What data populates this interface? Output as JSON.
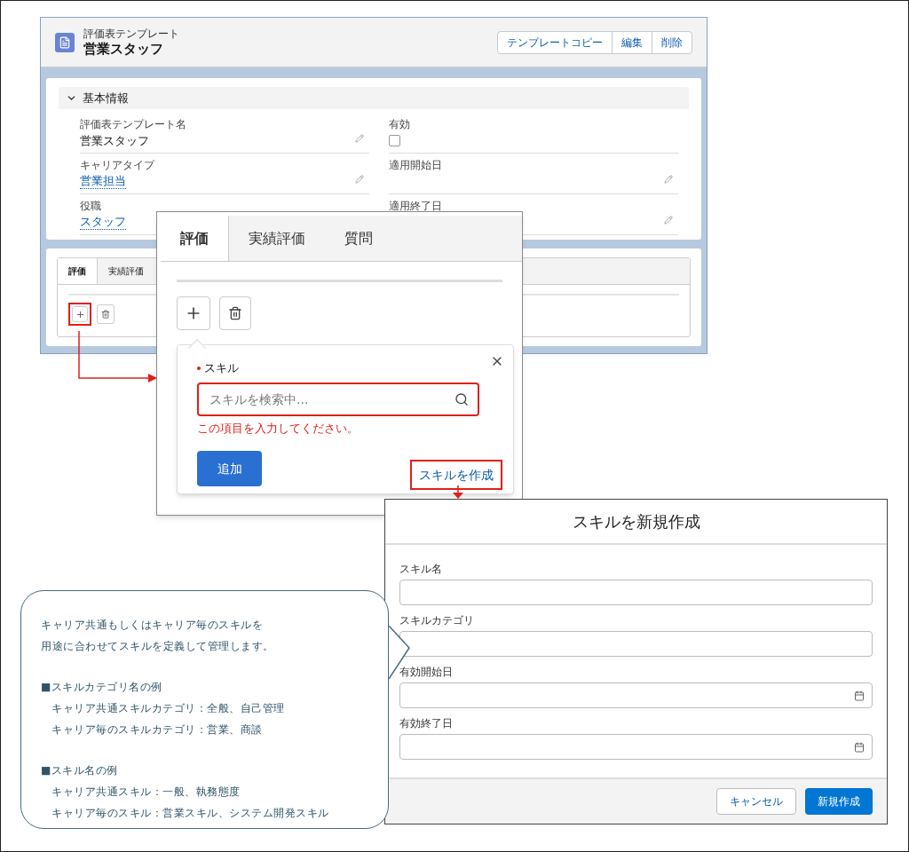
{
  "record_page": {
    "object_label": "評価表テンプレート",
    "title": "営業スタッフ",
    "actions": [
      "テンプレートコピー",
      "編集",
      "削除"
    ],
    "section": {
      "title": "基本情報",
      "expanded": true
    },
    "fields": [
      {
        "label": "評価表テンプレート名",
        "value": "営業スタッフ",
        "kind": "text"
      },
      {
        "label": "有効",
        "kind": "checkbox",
        "checked": false
      },
      {
        "label": "キャリアタイプ",
        "value": "営業担当",
        "kind": "link"
      },
      {
        "label": "適用開始日",
        "kind": "date"
      },
      {
        "label": "役職",
        "value": "スタッフ",
        "kind": "link"
      },
      {
        "label": "適用終了日",
        "kind": "date"
      }
    ],
    "tabs": [
      {
        "label": "評価",
        "selected": true
      },
      {
        "label": "実績評価",
        "selected": false
      }
    ]
  },
  "popup": {
    "tabs": [
      {
        "label": "評価",
        "selected": true
      },
      {
        "label": "実績評価",
        "selected": false
      },
      {
        "label": "質問",
        "selected": false
      }
    ],
    "field": {
      "label": "スキル",
      "required": true,
      "placeholder": "スキルを検索中...",
      "error": "この項目を入力してください。"
    },
    "add_button": "追加",
    "create_link": "スキルを作成"
  },
  "modal": {
    "title": "スキルを新規作成",
    "fields": [
      {
        "label": "スキル名",
        "kind": "text"
      },
      {
        "label": "スキルカテゴリ",
        "kind": "text"
      },
      {
        "label": "有効開始日",
        "kind": "date"
      },
      {
        "label": "有効終了日",
        "kind": "date"
      }
    ],
    "buttons": [
      {
        "label": "キャンセル",
        "kind": "neutral"
      },
      {
        "label": "新規作成",
        "kind": "brand"
      }
    ]
  },
  "callout": {
    "lines": [
      {
        "text": "キャリア共通もしくはキャリア毎のスキルを",
        "kind": "text"
      },
      {
        "text": "用途に合わせてスキルを定義して管理します。",
        "kind": "text"
      },
      {
        "text": "■スキルカテゴリ名の例",
        "kind": "heading"
      },
      {
        "text": "キャリア共通スキルカテゴリ：全般、自己管理",
        "kind": "item"
      },
      {
        "text": "キャリア毎のスキルカテゴリ：営業、商談",
        "kind": "item"
      },
      {
        "text": "■スキル名の例",
        "kind": "heading"
      },
      {
        "text": "キャリア共通スキル：一般、執務態度",
        "kind": "item"
      },
      {
        "text": "キャリア毎のスキル：営業スキル、システム開発スキル",
        "kind": "item"
      }
    ]
  }
}
